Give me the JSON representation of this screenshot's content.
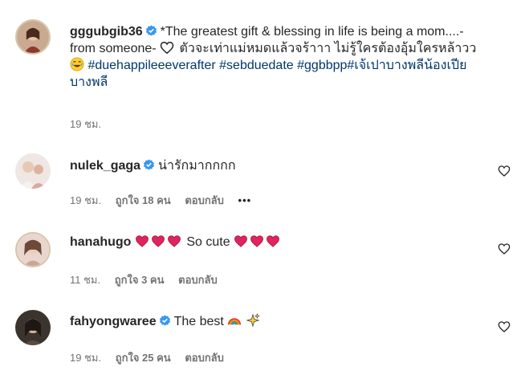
{
  "caption": {
    "username": "gggubgib36",
    "text_part1": "*The greatest gift & blessing in life is being a mom....- from someone-",
    "text_part2": "ตัวจะเท่าแม่หมดแล้วจร้าาา ไม่รู้ใครต้องอุ้มใครหล้าวว",
    "hashtags": [
      "#duehappileeeverafter",
      "#sebduedate",
      "#ggbbpp",
      "#เจ้เปาบางพลีน้องเปียบางพลี"
    ],
    "time": "19 ชม."
  },
  "comments": [
    {
      "username": "nulek_gaga",
      "text": "น่ารักมากกกก",
      "time": "19 ชม.",
      "likes": "ถูกใจ 18 คน",
      "reply": "ตอบกลับ",
      "more": "•••"
    },
    {
      "username": "hanahugo",
      "text": "So cute",
      "time": "11 ชม.",
      "likes": "ถูกใจ 3 คน",
      "reply": "ตอบกลับ"
    },
    {
      "username": "fahyongwaree",
      "text": "The best",
      "time": "19 ชม.",
      "likes": "ถูกใจ 25 คน",
      "reply": "ตอบกลับ"
    }
  ],
  "icons": {
    "verified": "verified-badge-icon",
    "like": "heart-outline-icon",
    "emoji_heart": "red-heart-emoji",
    "emoji_outline_heart": "white-heart-emoji",
    "emoji_laugh": "laughing-emoji",
    "emoji_rainbow": "rainbow-emoji",
    "emoji_sparkles": "sparkles-emoji"
  },
  "colors": {
    "verified_blue": "#3897f0",
    "hashtag": "#00376b",
    "meta_gray": "#737373",
    "heart_red": "#e0245e"
  }
}
